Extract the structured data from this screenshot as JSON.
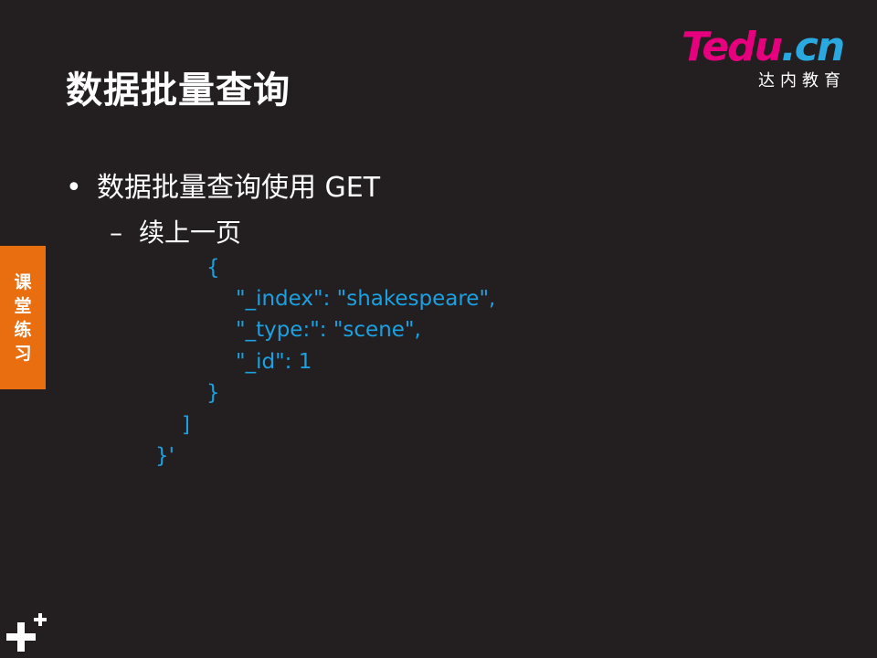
{
  "title": "数据批量查询",
  "logo": {
    "brand_main": "Tedu",
    "brand_suffix": ".cn",
    "subtitle": "达内教育",
    "brand_color": "#e6007e",
    "suffix_color": "#2aa8e0"
  },
  "bullet": {
    "symbol": "•",
    "text": "数据批量查询使用 GET"
  },
  "sub_bullet": {
    "symbol": "–",
    "text": "续上一页"
  },
  "code": [
    "{",
    "\"_index\": \"shakespeare\",",
    "\"_type:\": \"scene\",",
    "\"_id\": 1",
    "}",
    "]",
    "}'"
  ],
  "side_tab": {
    "chars": [
      "课",
      "堂",
      "练",
      "习"
    ],
    "color": "#e86e10"
  },
  "corner_icon": "plus-plus-icon",
  "colors": {
    "background": "#231f20",
    "code": "#1ba1e2",
    "text": "#ffffff"
  }
}
